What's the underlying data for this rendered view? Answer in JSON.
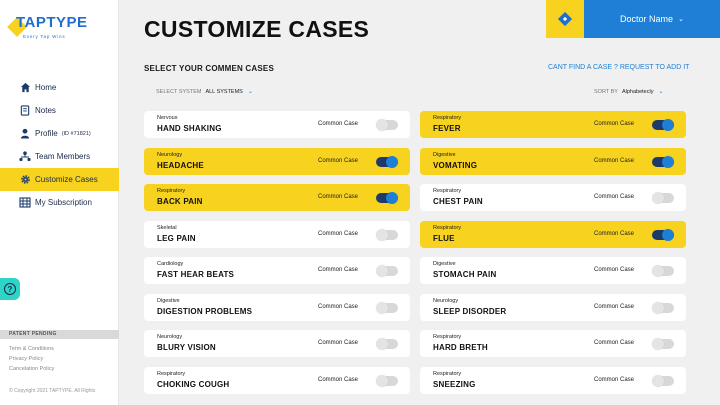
{
  "brand": {
    "name": "TAPTYPE",
    "tagline": "Every Tap Wins"
  },
  "sidebar": {
    "items": [
      {
        "label": "Home",
        "icon": "home-icon",
        "active": false
      },
      {
        "label": "Notes",
        "icon": "notes-icon",
        "active": false
      },
      {
        "label": "Profile",
        "id_text": "(ID #71821)",
        "icon": "user-icon",
        "active": false
      },
      {
        "label": "Team Members",
        "icon": "team-icon",
        "active": false
      },
      {
        "label": "Customize Cases",
        "icon": "gear-icon",
        "active": true
      },
      {
        "label": "My Subscription",
        "icon": "subscription-icon",
        "active": false
      }
    ],
    "help_icon": "?",
    "patent": "PATENT PENDING",
    "links": [
      "Term & Conditions",
      "Privacy Policy",
      "Cancelation Policy"
    ],
    "copyright": "© Copyright 2021 TAPTYPE. All Rights"
  },
  "header": {
    "title": "CUSTOMIZE CASES",
    "user_name": "Doctor Name",
    "colors": {
      "accent_yellow": "#f7d21e",
      "accent_blue": "#1f7fd6",
      "toggle_dark": "#1c3a6a"
    }
  },
  "main": {
    "subtitle": "SELECT YOUR COMMEN CASES",
    "request_link": "CANT FIND A CASE ? REQUEST TO ADD IT",
    "filter": {
      "label": "SELECT SYSTEM",
      "value": "ALL SYSTEMS"
    },
    "sort": {
      "label": "SORT BY",
      "value": "Alphabetecly"
    },
    "toggle_label": "Common Case",
    "cases": [
      {
        "system": "Nervous",
        "name": "HAND SHAKING",
        "on": false
      },
      {
        "system": "Respiratory",
        "name": "FEVER",
        "on": true
      },
      {
        "system": "Neurology",
        "name": "HEADACHE",
        "on": true
      },
      {
        "system": "Digestive",
        "name": "VOMATING",
        "on": true
      },
      {
        "system": "Respiratory",
        "name": "BACK PAIN",
        "on": true
      },
      {
        "system": "Respiratory",
        "name": "CHEST PAIN",
        "on": false
      },
      {
        "system": "Skeletal",
        "name": "LEG PAIN",
        "on": false
      },
      {
        "system": "Respiratory",
        "name": "FLUE",
        "on": true
      },
      {
        "system": "Cardiology",
        "name": "FAST HEAR BEATS",
        "on": false
      },
      {
        "system": "Digestive",
        "name": "STOMACH PAIN",
        "on": false
      },
      {
        "system": "Digestive",
        "name": "DIGESTION PROBLEMS",
        "on": false
      },
      {
        "system": "Neurology",
        "name": "SLEEP DISORDER",
        "on": false
      },
      {
        "system": "Neurology",
        "name": "BLURY VISION",
        "on": false
      },
      {
        "system": "Respiratory",
        "name": "HARD BRETH",
        "on": false
      },
      {
        "system": "Respiratory",
        "name": "CHOKING COUGH",
        "on": false
      },
      {
        "system": "Respiratory",
        "name": "SNEEZING",
        "on": false
      }
    ]
  }
}
